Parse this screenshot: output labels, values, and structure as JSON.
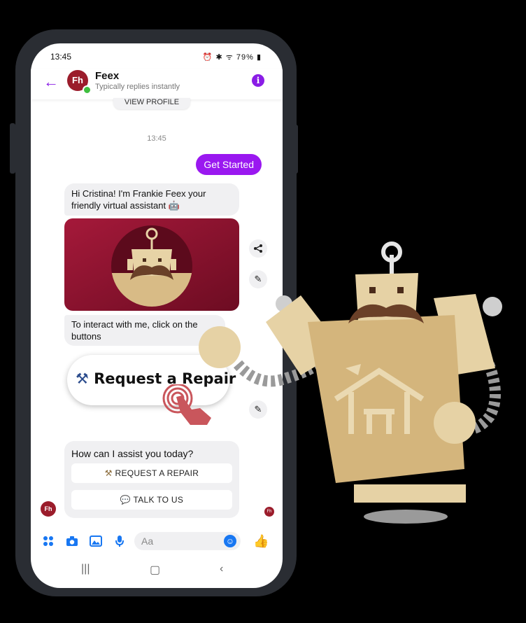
{
  "status_bar": {
    "time": "13:45",
    "icons": "⏰ ✱ ᯤ ",
    "battery": "79%"
  },
  "chat_header": {
    "back_icon": "arrow-left-icon",
    "avatar_text": "Fh",
    "name": "Feex",
    "subtitle": "Typically replies instantly",
    "info_icon": "info-icon"
  },
  "view_profile_label": "VIEW PROFILE",
  "timestamp": "13:45",
  "user_message": "Get Started",
  "bot_messages": {
    "greeting": "Hi Cristina!  I'm Frankie Feex your friendly virtual assistant 🤖",
    "instruction": "To interact with me, click on the buttons"
  },
  "callout": {
    "icon": "⚒",
    "label": "Request a Repair"
  },
  "quick_replies": {
    "question": "How can I assist you today?",
    "buttons": [
      {
        "icon": "⚒",
        "label": "REQUEST A REPAIR"
      },
      {
        "icon": "💬",
        "label": "TALK TO US"
      }
    ]
  },
  "composer": {
    "placeholder": "Aa"
  },
  "colors": {
    "accent": "#9a18f0",
    "brand": "#9b1c2b",
    "messenger_blue": "#1877f2",
    "robot_tan": "#d4b57c"
  }
}
